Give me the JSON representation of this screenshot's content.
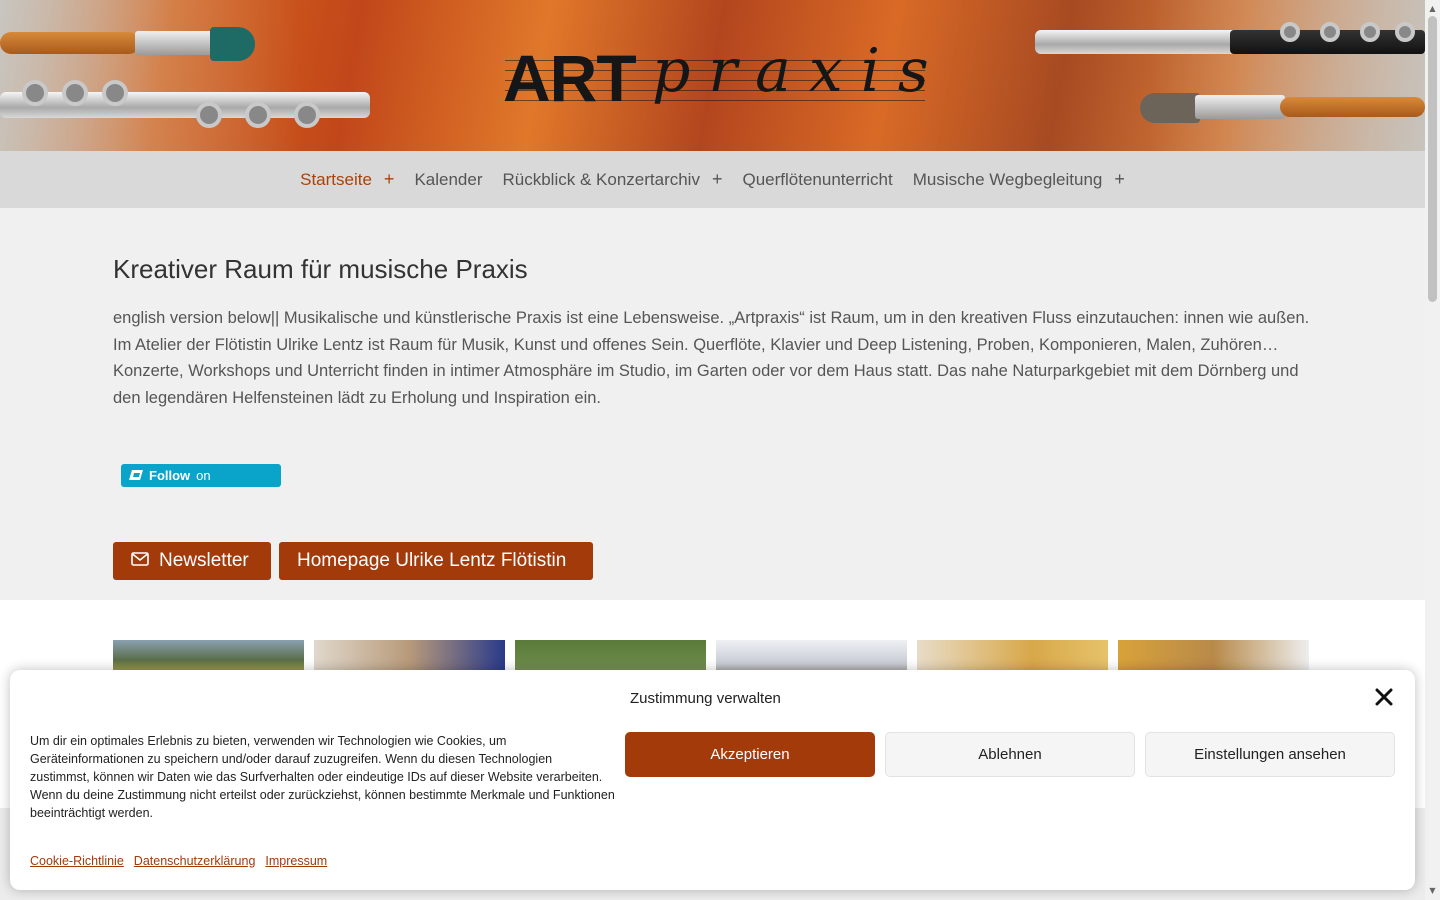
{
  "header": {
    "logo_art": "ART",
    "logo_praxis": "praxis"
  },
  "nav": {
    "items": [
      {
        "label": "Startseite",
        "has_submenu": true,
        "active": true
      },
      {
        "label": "Kalender",
        "has_submenu": false,
        "active": false
      },
      {
        "label": "Rückblick & Konzertarchiv",
        "has_submenu": true,
        "active": false
      },
      {
        "label": "Querflötenunterricht",
        "has_submenu": false,
        "active": false
      },
      {
        "label": "Musische Wegbegleitung",
        "has_submenu": true,
        "active": false
      }
    ],
    "submenu_symbol": "+"
  },
  "main": {
    "headline": "Kreativer Raum für musische Praxis",
    "intro": "english version below|| Musikalische und künstlerische Praxis ist eine Lebensweise. „Artpraxis“ ist Raum, um in den kreativen Fluss einzutauchen: innen wie außen. Im Atelier der Flötistin Ulrike Lentz ist Raum für Musik, Kunst und offenes Sein. Querflöte, Klavier und Deep Listening, Proben, Komponieren, Malen, Zuhören… Konzerte, Workshops und Unterricht finden in intimer Atmosphäre im Studio, im Garten oder vor dem Haus statt. Das nahe Naturparkgebiet mit dem Dörnberg und den legendären Helfensteinen lädt zu Erholung und Inspiration ein.",
    "follow_bold": "Follow",
    "follow_suffix": "on",
    "newsletter_label": "Newsletter",
    "homepage_label": "Homepage Ulrike Lentz Flötistin"
  },
  "cookie": {
    "title": "Zustimmung verwalten",
    "text": "Um dir ein optimales Erlebnis zu bieten, verwenden wir Technologien wie Cookies, um Geräteinformationen zu speichern und/oder darauf zuzugreifen. Wenn du diesen Technologien zustimmst, können wir Daten wie das Surfverhalten oder eindeutige IDs auf dieser Website verarbeiten. Wenn du deine Zustimmung nicht erteilst oder zurückziehst, können bestimmte Merkmale und Funktionen beeinträchtigt werden.",
    "accept": "Akzeptieren",
    "deny": "Ablehnen",
    "settings": "Einstellungen ansehen",
    "links": {
      "cookie_policy": "Cookie-Richtlinie",
      "privacy": "Datenschutzerklärung",
      "imprint": "Impressum"
    }
  },
  "colors": {
    "accent": "#a33a0a",
    "nav_active": "#a9420a",
    "nav_bg": "#d9d9d9",
    "main_bg": "#f0f0f0",
    "follow_bg": "#0aa3c9"
  },
  "gallery": {
    "thumb_colors": [
      "#7a8b6a",
      "#c9b89a",
      "#6a7f4a",
      "#e6e6e8",
      "#d9b06a",
      "#c79a3a"
    ]
  }
}
